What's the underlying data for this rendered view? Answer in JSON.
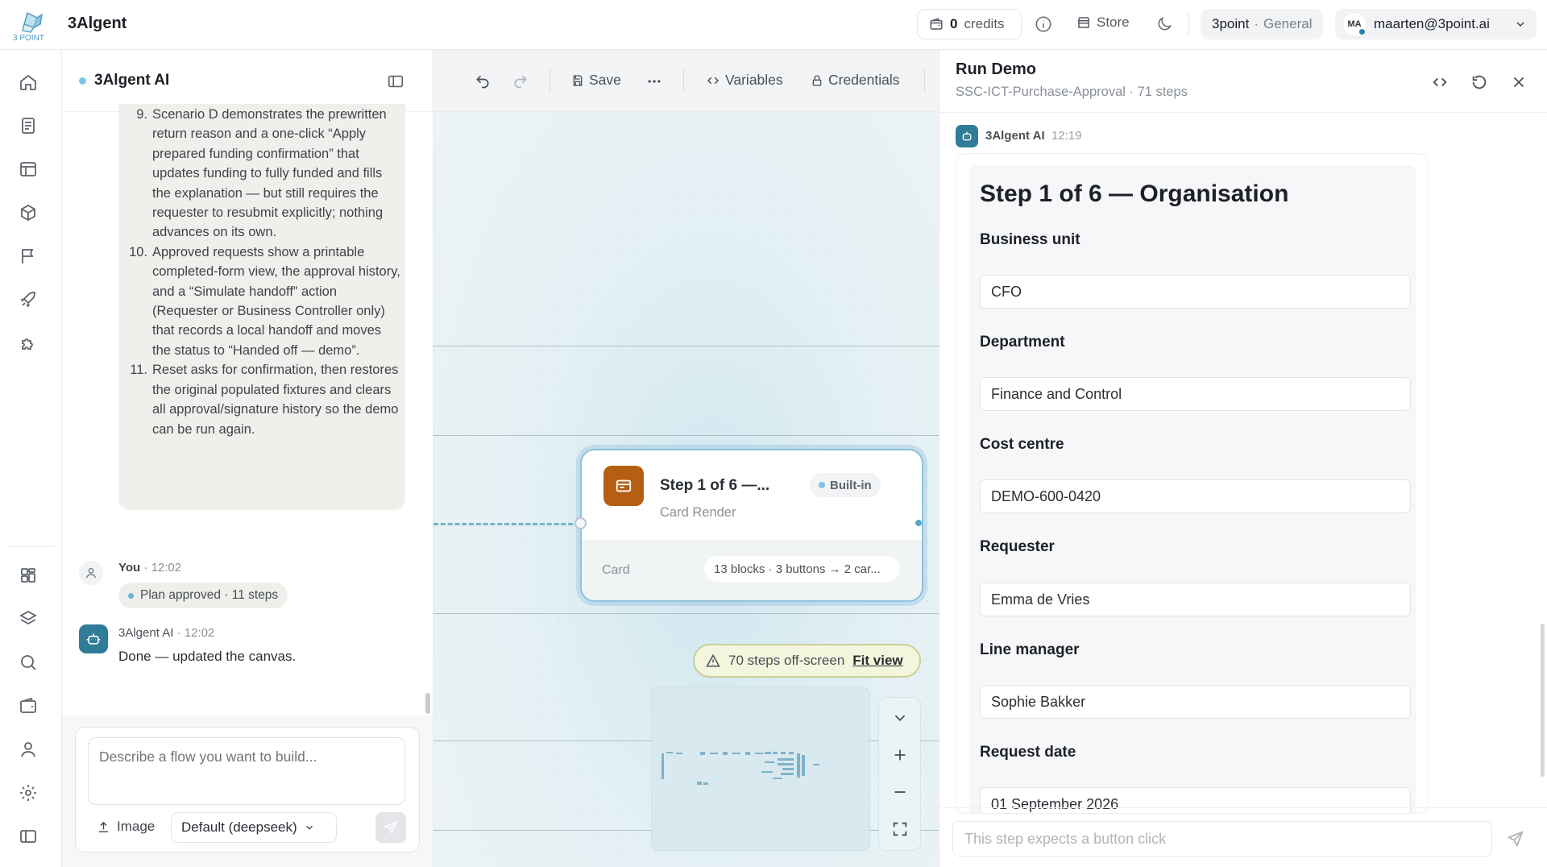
{
  "app": {
    "name": "3Algent",
    "logo_text": "3 POINT",
    "credits_value": "0",
    "credits_label": "credits",
    "store_label": "Store",
    "workspace_org": "3point",
    "workspace_sep": "·",
    "workspace_name": "General",
    "user_initials": "MA",
    "user_email": "maarten@3point.ai"
  },
  "rail": {
    "icons": [
      "home-icon",
      "document-icon",
      "layout-icon",
      "package-icon",
      "flag-icon",
      "rocket-icon",
      "puzzle-icon",
      "apps-icon",
      "layers-icon",
      "search-icon",
      "wallet-icon",
      "user-icon",
      "settings-icon",
      "sidebar-icon"
    ]
  },
  "chat": {
    "title": "3Algent AI",
    "plan_items": [
      {
        "num": "9.",
        "text": "Scenario D demonstrates the prewritten return reason and a one-click “Apply prepared funding confirmation” that updates funding to fully funded and fills the explanation — but still requires the requester to resubmit explicitly; nothing advances on its own."
      },
      {
        "num": "10.",
        "text": "Approved requests show a printable completed-form view, the approval history, and a “Simulate handoff” action (Requester or Business Controller only) that records a local handoff and moves the status to “Handed off — demo”."
      },
      {
        "num": "11.",
        "text": "Reset asks for confirmation, then restores the original populated fixtures and clears all approval/signature history so the demo can be run again."
      }
    ],
    "you_name": "You",
    "you_time": "12:02",
    "plan_pill": "Plan approved · 11 steps",
    "bot_name": "3Algent AI",
    "bot_time": "12:02",
    "bot_text": "Done — updated the canvas.",
    "composer_placeholder": "Describe a flow you want to build...",
    "image_label": "Image",
    "model_label": "Default (deepseek)"
  },
  "canvas": {
    "toolbar": {
      "save_label": "Save",
      "variables_label": "Variables",
      "credentials_label": "Credentials"
    },
    "node": {
      "title": "Step 1 of 6 —...",
      "badge": "Built-in",
      "subtitle": "Card Render",
      "foot_label": "Card",
      "foot_value": "13 blocks · 3 buttons → 2 car..."
    },
    "offscreen_text": "70 steps off-screen",
    "fit_view_label": "Fit view"
  },
  "run": {
    "title": "Run Demo",
    "subtitle": "SSC-ICT-Purchase-Approval · 71 steps",
    "bot_name": "3Algent AI",
    "bot_time": "12:19",
    "form_title": "Step 1 of 6 — Organisation",
    "fields": [
      {
        "label": "Business unit",
        "value": "CFO"
      },
      {
        "label": "Department",
        "value": "Finance and Control"
      },
      {
        "label": "Cost centre",
        "value": "DEMO-600-0420"
      },
      {
        "label": "Requester",
        "value": "Emma de Vries"
      },
      {
        "label": "Line manager",
        "value": "Sophie Bakker"
      },
      {
        "label": "Request date",
        "value": "01 September 2026"
      }
    ],
    "input_placeholder": "This step expects a button click"
  }
}
